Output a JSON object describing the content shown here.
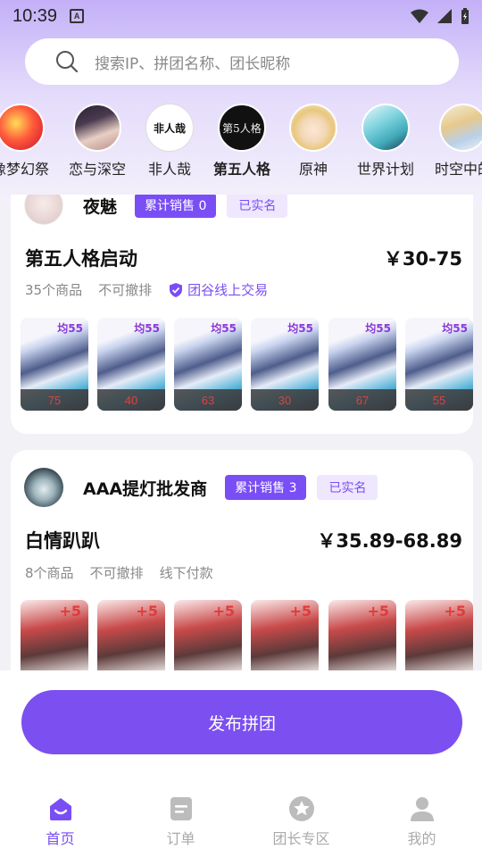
{
  "status_bar": {
    "time": "10:39",
    "app_icon_letter": "A"
  },
  "search": {
    "placeholder": "搜索IP、拼团名称、团长昵称"
  },
  "ip_categories": [
    {
      "label": "像梦幻祭",
      "active": false
    },
    {
      "label": "恋与深空",
      "active": false
    },
    {
      "label": "非人哉",
      "active": false,
      "avatar_text": "非人哉"
    },
    {
      "label": "第五人格",
      "active": true,
      "avatar_text": "第5人格"
    },
    {
      "label": "原神",
      "active": false
    },
    {
      "label": "世界计划",
      "active": false
    },
    {
      "label": "时空中的",
      "active": false
    }
  ],
  "groups": [
    {
      "leader_name": "夜魅",
      "sales_badge": "累计销售 0",
      "verified_badge": "已实名",
      "title": "第五人格启动",
      "price": "￥30-75",
      "item_count": "35个商品",
      "no_cancel": "不可撤排",
      "trade_type": "团谷线上交易",
      "thumb_caption_top": "均55",
      "thumbs": [
        "75",
        "40",
        "63",
        "30",
        "67",
        "55"
      ]
    },
    {
      "leader_name": "AAA提灯批发商",
      "sales_badge": "累计销售 3",
      "verified_badge": "已实名",
      "title": "白情趴趴",
      "price": "￥35.89-68.89",
      "item_count": "8个商品",
      "no_cancel": "不可撤排",
      "trade_type": "线下付款",
      "thumb_caption_top": "+5",
      "thumbs": [
        "",
        "",
        "",
        "",
        "",
        ""
      ]
    }
  ],
  "publish": {
    "label": "发布拼团"
  },
  "tab_bar": [
    {
      "label": "首页",
      "icon": "home-icon",
      "active": true
    },
    {
      "label": "订单",
      "icon": "order-icon",
      "active": false
    },
    {
      "label": "团长专区",
      "icon": "star-icon",
      "active": false
    },
    {
      "label": "我的",
      "icon": "profile-icon",
      "active": false
    }
  ],
  "colors": {
    "accent": "#7a4ef5",
    "price_tag": "#e04040"
  }
}
